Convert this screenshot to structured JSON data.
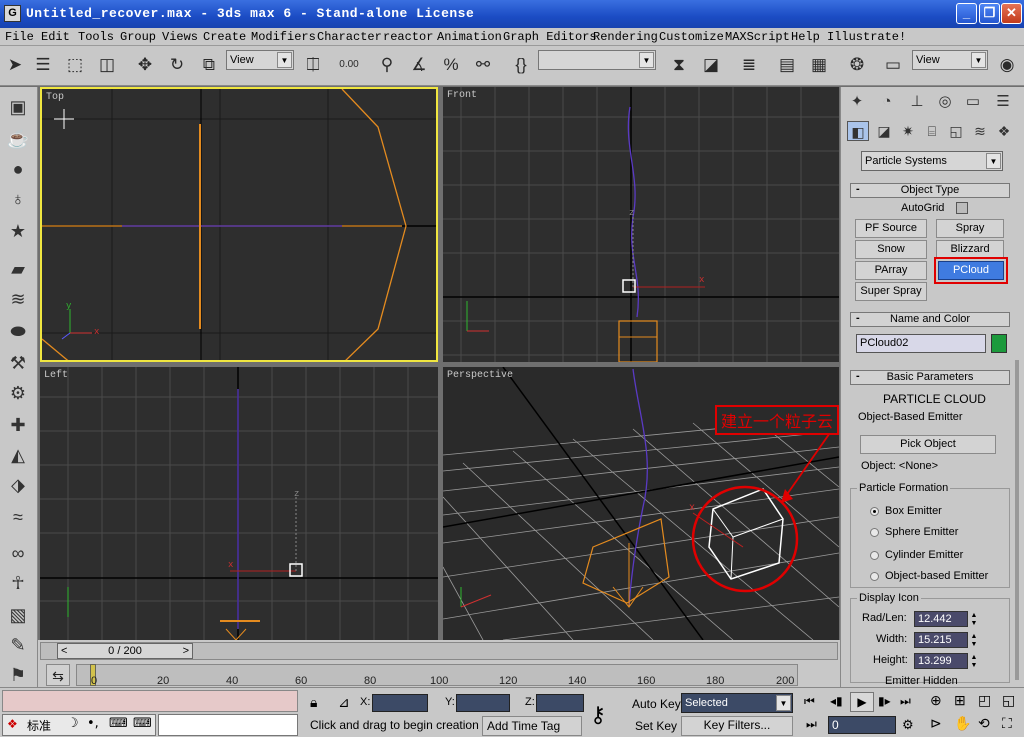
{
  "window": {
    "title": "Untitled_recover.max - 3ds max 6 - Stand-alone License"
  },
  "menu": [
    "File",
    "Edit",
    "Tools",
    "Group",
    "Views",
    "Create",
    "Modifiers",
    "Character",
    "reactor",
    "Animation",
    "Graph Editors",
    "Rendering",
    "Customize",
    "MAXScript",
    "Help",
    "Illustrate!"
  ],
  "toolbar": {
    "ref_coord": "View",
    "snap_value": "0.00",
    "named_selection": "",
    "ref_coord2": "View"
  },
  "viewports": {
    "top": "Top",
    "front": "Front",
    "left": "Left",
    "perspective": "Perspective"
  },
  "viewport_axes": {
    "x": "x",
    "y": "y",
    "z": "z"
  },
  "annotation": {
    "text": "建立一个粒子云",
    "color": "#e00000"
  },
  "command_panel": {
    "category": "Particle Systems",
    "object_type": {
      "title": "Object Type",
      "autogrid": "AutoGrid",
      "buttons": [
        "PF Source",
        "Spray",
        "Snow",
        "Blizzard",
        "PArray",
        "PCloud",
        "Super Spray"
      ],
      "active": "PCloud"
    },
    "name_color": {
      "title": "Name and Color",
      "name": "PCloud02",
      "color": "#1c9a3c"
    },
    "basic_params": {
      "title": "Basic Parameters",
      "heading": "PARTICLE CLOUD",
      "emitter_label": "Object-Based Emitter",
      "pick_button": "Pick Object",
      "object_label": "Object: <None>",
      "formation_title": "Particle Formation",
      "formations": [
        "Box Emitter",
        "Sphere Emitter",
        "Cylinder Emitter",
        "Object-based Emitter"
      ],
      "selected_formation": "Box Emitter",
      "display_icon_title": "Display Icon",
      "rad_len_label": "Rad/Len:",
      "rad_len": "12.442",
      "width_label": "Width:",
      "width": "15.215",
      "height_label": "Height:",
      "height": "13.299",
      "cut_label": "Emitter Hidden"
    }
  },
  "timeline": {
    "frame_display": "0 / 200",
    "ticks": [
      "0",
      "20",
      "40",
      "60",
      "80",
      "100",
      "120",
      "140",
      "160",
      "180",
      "200"
    ]
  },
  "status": {
    "x_label": "X:",
    "y_label": "Y:",
    "z_label": "Z:",
    "prompt": "Click and drag to begin creation pro",
    "add_time_tag": "Add Time Tag",
    "auto_key": "Auto Key",
    "set_key": "Set Key",
    "key_mode": "Selected",
    "key_filters": "Key Filters...",
    "current_frame": "0",
    "ime": "标准"
  }
}
